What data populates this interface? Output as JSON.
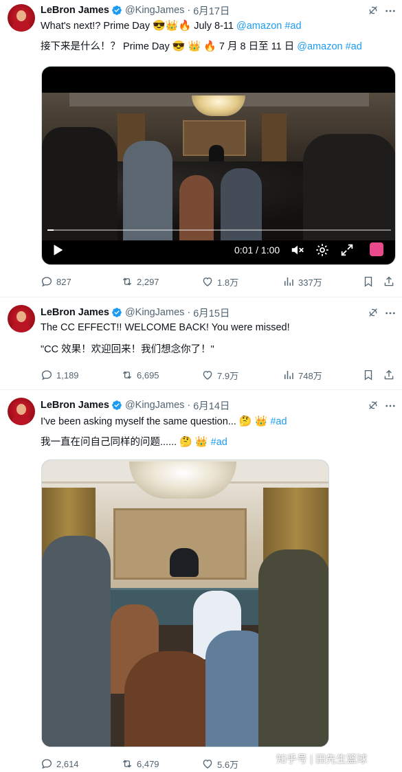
{
  "colors": {
    "link": "#1d9bf0",
    "muted": "#536471",
    "text": "#0f1419",
    "verified": "#1d9bf0"
  },
  "tweets": [
    {
      "author": {
        "name": "LeBron James",
        "handle": "@KingJames",
        "date": "6月17日",
        "verified": true
      },
      "text": {
        "en": {
          "prefix": "What's next!? Prime Day ",
          "suffix": " July 8-11 ",
          "mention": "@amazon",
          "hashtag": "#ad"
        },
        "zh": {
          "prefix": "接下来是什么！？ Prime Day ",
          "suffix": " 7 月 8 日至 11 日 ",
          "mention": "@amazon",
          "hashtag": "#ad"
        }
      },
      "emojis": [
        "😎",
        "👑",
        "🔥"
      ],
      "media": {
        "type": "video",
        "timecode": "0:01 / 1:00",
        "progress": 0.017
      },
      "stats": {
        "replies": "827",
        "reposts": "2,297",
        "likes": "1.8万",
        "views": "337万"
      }
    },
    {
      "author": {
        "name": "LeBron James",
        "handle": "@KingJames",
        "date": "6月15日",
        "verified": true
      },
      "text": {
        "en": "The CC EFFECT!! WELCOME BACK! You were missed!",
        "zh": "\"CC 效果！欢迎回来！我们想念你了！\""
      },
      "stats": {
        "replies": "1,189",
        "reposts": "6,695",
        "likes": "7.9万",
        "views": "748万"
      }
    },
    {
      "author": {
        "name": "LeBron James",
        "handle": "@KingJames",
        "date": "6月14日",
        "verified": true
      },
      "text": {
        "en": {
          "prefix": "I've been asking myself the same question... ",
          "hashtag": "#ad"
        },
        "zh": {
          "prefix": "我一直在问自己同样的问题...... ",
          "hashtag": "#ad"
        }
      },
      "emojis": [
        "🤔",
        "👑"
      ],
      "media": {
        "type": "image"
      },
      "stats": {
        "replies": "2,614",
        "reposts": "6,479",
        "likes": "5.6万",
        "views": ""
      }
    }
  ],
  "watermark": "知乎号 | 田先生篮球"
}
